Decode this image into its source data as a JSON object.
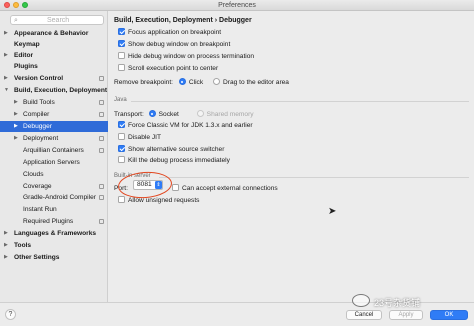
{
  "window": {
    "title": "Preferences"
  },
  "search": {
    "placeholder": "Search"
  },
  "sidebar": {
    "items": [
      {
        "label": "Appearance & Behavior",
        "arrow": "▶",
        "bold": true
      },
      {
        "label": "Keymap",
        "arrow": "",
        "bold": true
      },
      {
        "label": "Editor",
        "arrow": "▶",
        "bold": true
      },
      {
        "label": "Plugins",
        "arrow": "",
        "bold": true
      },
      {
        "label": "Version Control",
        "arrow": "▶",
        "bold": true
      },
      {
        "label": "Build, Execution, Deployment",
        "arrow": "▼",
        "bold": true
      },
      {
        "label": "Build Tools",
        "arrow": "▶"
      },
      {
        "label": "Compiler",
        "arrow": "▶"
      },
      {
        "label": "Debugger",
        "arrow": "▶",
        "selected": true
      },
      {
        "label": "Deployment",
        "arrow": "▶"
      },
      {
        "label": "Arquillian Containers",
        "arrow": ""
      },
      {
        "label": "Application Servers",
        "arrow": ""
      },
      {
        "label": "Clouds",
        "arrow": ""
      },
      {
        "label": "Coverage",
        "arrow": ""
      },
      {
        "label": "Gradle-Android Compiler",
        "arrow": ""
      },
      {
        "label": "Instant Run",
        "arrow": ""
      },
      {
        "label": "Required Plugins",
        "arrow": ""
      },
      {
        "label": "Languages & Frameworks",
        "arrow": "▶",
        "bold": true
      },
      {
        "label": "Tools",
        "arrow": "▶",
        "bold": true
      },
      {
        "label": "Other Settings",
        "arrow": "▶",
        "bold": true
      }
    ]
  },
  "main": {
    "breadcrumb": "Build, Execution, Deployment › Debugger",
    "options": {
      "focus_app": "Focus application on breakpoint",
      "show_debug_window": "Show debug window on breakpoint",
      "hide_debug_window": "Hide debug window on process termination",
      "scroll_exec_point": "Scroll execution point to center"
    },
    "remove_breakpoint": {
      "label": "Remove breakpoint:",
      "click": "Click",
      "drag": "Drag to the editor area"
    },
    "java": {
      "section": "Java",
      "transport_label": "Transport:",
      "socket": "Socket",
      "shared_memory": "Shared memory",
      "force_classic": "Force Classic VM for JDK 1.3.x and earlier",
      "disable_jit": "Disable JIT",
      "show_alt_source": "Show alternative source switcher",
      "kill_process": "Kill the debug process immediately"
    },
    "builtin_server": {
      "section": "Built-in server",
      "port_label": "Port:",
      "port_value": "8081",
      "can_accept": "Can accept external connections",
      "allow_unsigned": "Allow unsigned requests"
    }
  },
  "footer": {
    "help": "?",
    "cancel": "Cancel",
    "apply": "Apply",
    "ok": "OK"
  },
  "watermark": {
    "text": "23号杂货铺"
  },
  "colors": {
    "accent": "#2f7cf6",
    "selection": "#2f6bd8",
    "annotation": "#e2461e"
  }
}
